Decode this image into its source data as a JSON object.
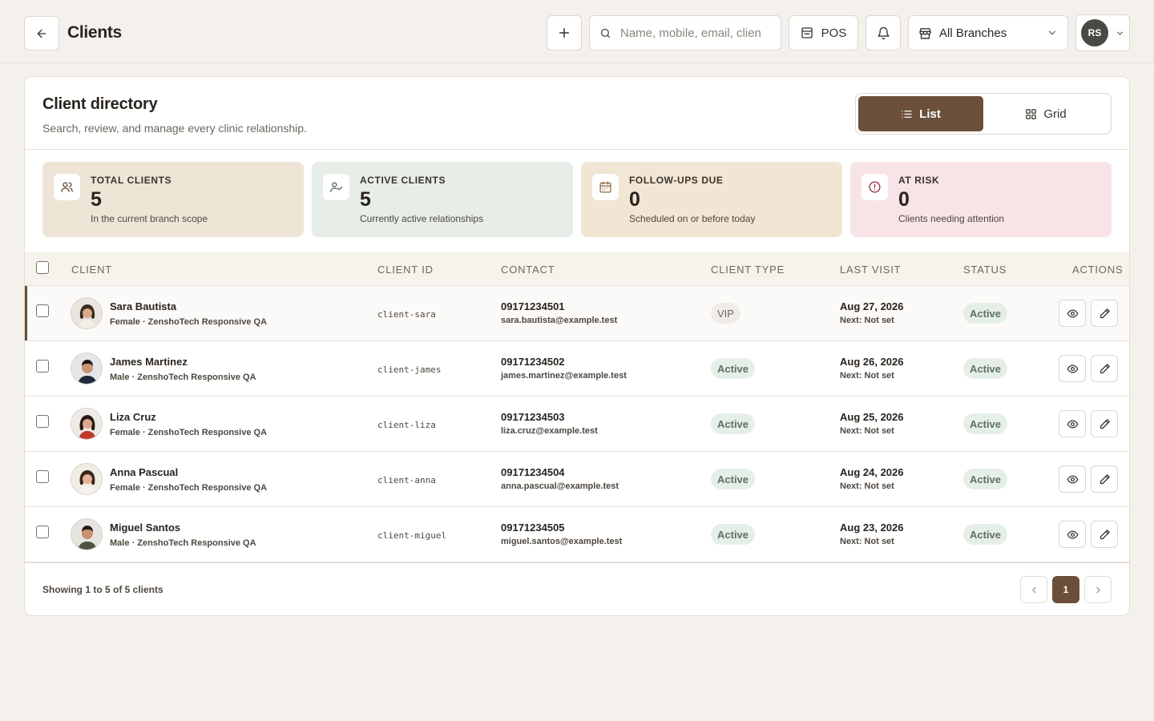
{
  "header": {
    "title": "Clients",
    "search_placeholder": "Name, mobile, email, clien",
    "pos_label": "POS",
    "branch_label": "All Branches",
    "user_initials": "RS"
  },
  "directory": {
    "title": "Client directory",
    "subtitle": "Search, review, and manage every clinic relationship.",
    "view_list": "List",
    "view_grid": "Grid"
  },
  "stats": [
    {
      "label": "TOTAL CLIENTS",
      "value": "5",
      "desc": "In the current branch scope",
      "bg": "#efe5d7",
      "icon": "users-icon"
    },
    {
      "label": "ACTIVE CLIENTS",
      "value": "5",
      "desc": "Currently active relationships",
      "bg": "#e6eee7",
      "icon": "user-check-icon"
    },
    {
      "label": "FOLLOW-UPS DUE",
      "value": "0",
      "desc": "Scheduled on or before today",
      "bg": "#f1e5d3",
      "icon": "calendar-icon"
    },
    {
      "label": "AT RISK",
      "value": "0",
      "desc": "Clients needing attention",
      "bg": "#f8e4e6",
      "icon": "alert-circle-icon"
    }
  ],
  "table": {
    "headers": [
      "CLIENT",
      "CLIENT ID",
      "CONTACT",
      "CLIENT TYPE",
      "LAST VISIT",
      "STATUS",
      "ACTIONS"
    ],
    "rows": [
      {
        "name": "Sara Bautista",
        "meta": "Female · ZenshoTech Responsive QA",
        "id": "client-sara",
        "phone": "09171234501",
        "email": "sara.bautista@example.test",
        "type": "VIP",
        "last_visit": "Aug 27, 2026",
        "next": "Next: Not set",
        "status": "Active"
      },
      {
        "name": "James Martinez",
        "meta": "Male · ZenshoTech Responsive QA",
        "id": "client-james",
        "phone": "09171234502",
        "email": "james.martinez@example.test",
        "type": "Active",
        "last_visit": "Aug 26, 2026",
        "next": "Next: Not set",
        "status": "Active"
      },
      {
        "name": "Liza Cruz",
        "meta": "Female · ZenshoTech Responsive QA",
        "id": "client-liza",
        "phone": "09171234503",
        "email": "liza.cruz@example.test",
        "type": "Active",
        "last_visit": "Aug 25, 2026",
        "next": "Next: Not set",
        "status": "Active"
      },
      {
        "name": "Anna Pascual",
        "meta": "Female · ZenshoTech Responsive QA",
        "id": "client-anna",
        "phone": "09171234504",
        "email": "anna.pascual@example.test",
        "type": "Active",
        "last_visit": "Aug 24, 2026",
        "next": "Next: Not set",
        "status": "Active"
      },
      {
        "name": "Miguel Santos",
        "meta": "Male · ZenshoTech Responsive QA",
        "id": "client-miguel",
        "phone": "09171234505",
        "email": "miguel.santos@example.test",
        "type": "Active",
        "last_visit": "Aug 23, 2026",
        "next": "Next: Not set",
        "status": "Active"
      }
    ]
  },
  "pagination": {
    "showing": "Showing 1 to 5 of 5 clients",
    "current_page": "1"
  },
  "colors": {
    "accent": "#6b4f3a",
    "background": "#f4f1ed"
  }
}
